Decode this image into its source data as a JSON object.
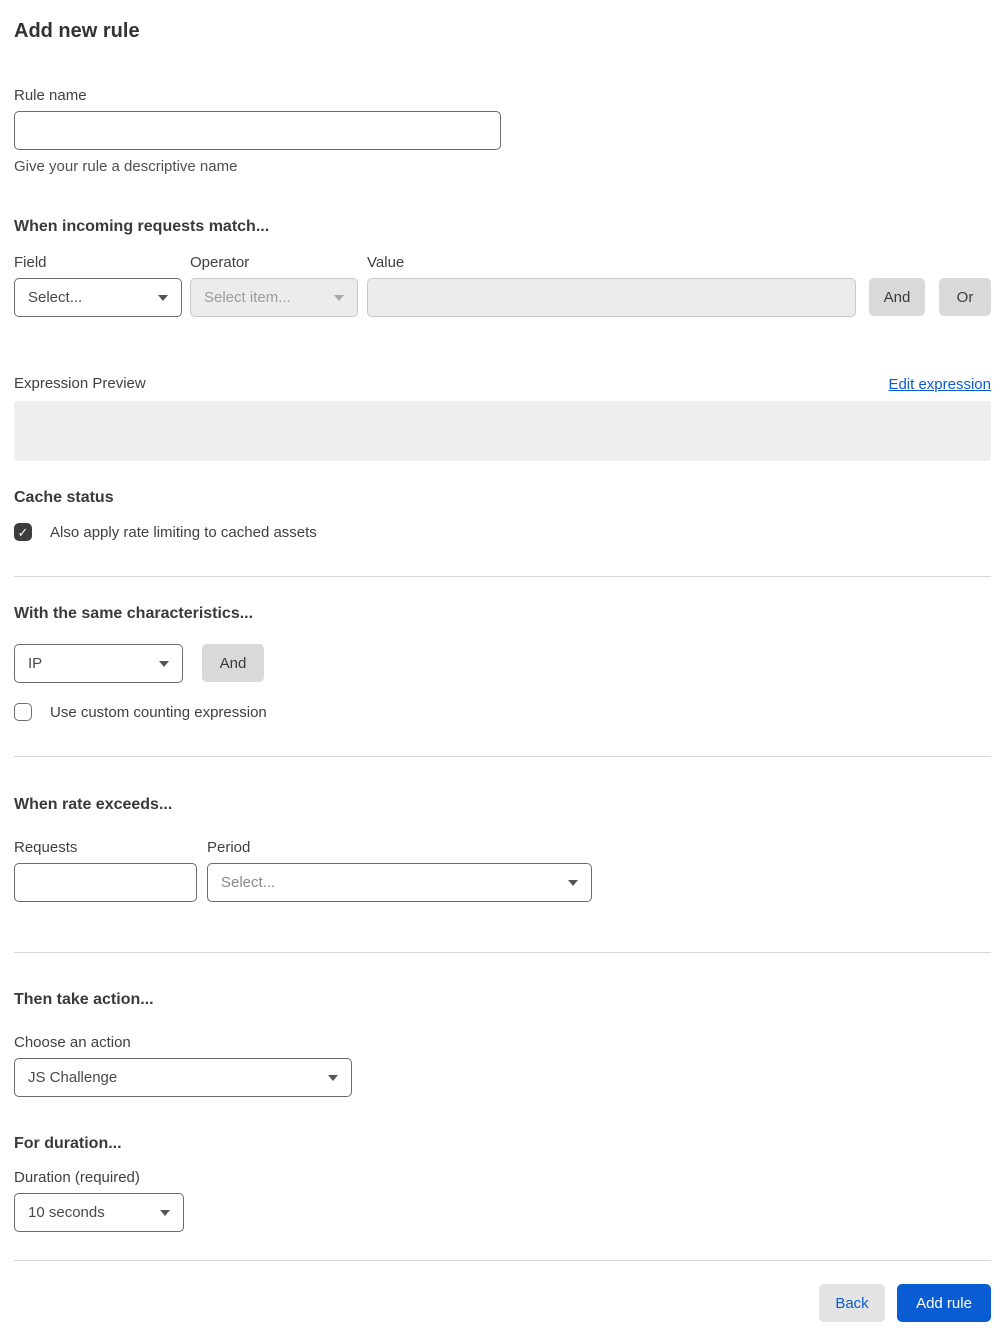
{
  "page": {
    "title": "Add new rule"
  },
  "colors": {
    "accent_blue": "#0a5cd2",
    "disabled_bg": "#ececec",
    "gray_button_bg": "#d9d9d9",
    "checkbox_checked_bg": "#3d3d3d",
    "preview_bg": "#efefef"
  },
  "rule_name": {
    "label": "Rule name",
    "value": "",
    "help": "Give your rule a descriptive name"
  },
  "match": {
    "heading": "When incoming requests match...",
    "field": {
      "label": "Field",
      "selected": "Select..."
    },
    "operator": {
      "label": "Operator",
      "selected": "Select item...",
      "disabled": true
    },
    "value": {
      "label": "Value",
      "value": "",
      "disabled": true
    },
    "and_label": "And",
    "or_label": "Or"
  },
  "expression": {
    "label": "Expression Preview",
    "edit_link": "Edit expression",
    "preview_value": ""
  },
  "cache": {
    "heading": "Cache status",
    "checkbox_label": "Also apply rate limiting to cached assets",
    "checked": true,
    "check_glyph": "✓"
  },
  "characteristics": {
    "heading": "With the same characteristics...",
    "selected": "IP",
    "and_label": "And",
    "custom_label": "Use custom counting expression",
    "custom_checked": false
  },
  "rate": {
    "heading": "When rate exceeds...",
    "requests": {
      "label": "Requests",
      "value": ""
    },
    "period": {
      "label": "Period",
      "selected": "Select..."
    }
  },
  "action": {
    "heading": "Then take action...",
    "choose_label": "Choose an action",
    "selected": "JS Challenge"
  },
  "duration": {
    "heading": "For duration...",
    "label": "Duration (required)",
    "selected": "10 seconds"
  },
  "footer": {
    "back_label": "Back",
    "submit_label": "Add rule"
  }
}
